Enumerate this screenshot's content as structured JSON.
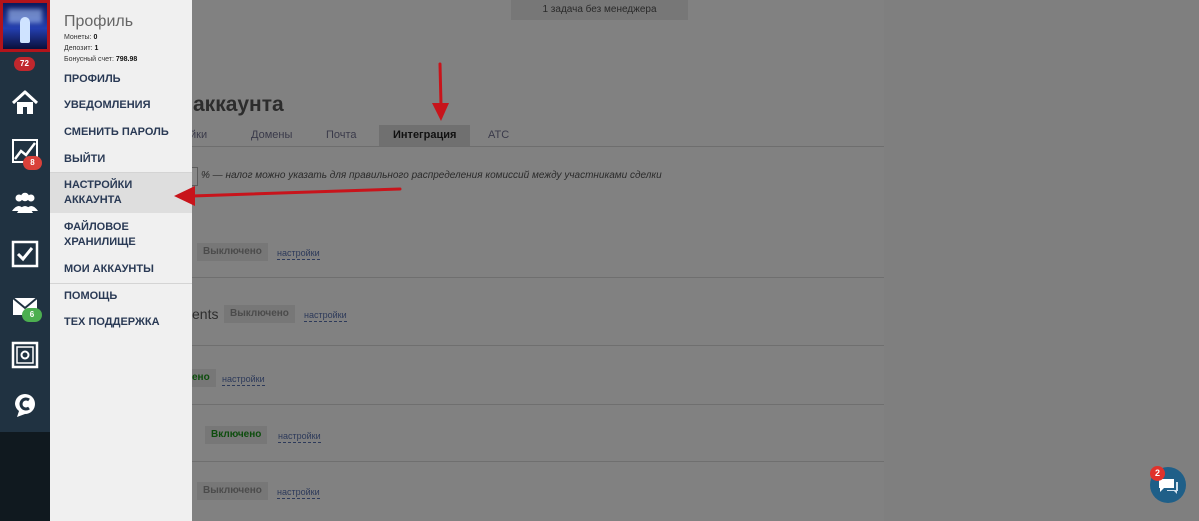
{
  "background": {
    "top_note": "1 задача без менеджера",
    "page_title": "аккаунта",
    "tabs": [
      {
        "label": "йки"
      },
      {
        "label": "Домены"
      },
      {
        "label": "Почта"
      },
      {
        "label": "Интеграция",
        "active": true
      },
      {
        "label": "АТС"
      }
    ],
    "tax_note": "% — налог можно указать для правильного распределения комиссий между участниками сделки",
    "rows": [
      {
        "fragment": "",
        "status": "Выключено",
        "enabled": false,
        "link": "настройки"
      },
      {
        "fragment": "ents",
        "status": "Выключено",
        "enabled": false,
        "link": "настройки"
      },
      {
        "fragment": "",
        "status": "ено",
        "enabled": true,
        "link": "настройки"
      },
      {
        "fragment": "",
        "status": "Включено",
        "enabled": true,
        "link": "настройки"
      },
      {
        "fragment": "",
        "status": "Выключено",
        "enabled": false,
        "link": "настройки"
      }
    ]
  },
  "rail": {
    "avatar_badge": "72",
    "icons": [
      {
        "name": "home-icon"
      },
      {
        "name": "analytics-icon",
        "badge": "8",
        "badge_color": "#d9413a"
      },
      {
        "name": "people-icon"
      },
      {
        "name": "checkbox-tasks-icon"
      },
      {
        "name": "mail-icon",
        "badge": "6",
        "badge_color": "#4caf50"
      },
      {
        "name": "safe-icon"
      },
      {
        "name": "currency-icon"
      }
    ]
  },
  "menu": {
    "title": "Профиль",
    "stats": [
      {
        "label": "Монеты:",
        "value": "0"
      },
      {
        "label": "Депозит:",
        "value": "1"
      },
      {
        "label": "Бонусный счет:",
        "value": "798.98"
      }
    ],
    "items": [
      {
        "label": "ПРОФИЛЬ"
      },
      {
        "label": "УВЕДОМЛЕНИЯ"
      },
      {
        "label": "СМЕНИТЬ ПАРОЛЬ"
      },
      {
        "label": "ВЫЙТИ"
      },
      {
        "label": "НАСТРОЙКИ АККАУНТА",
        "active": true
      },
      {
        "label": "ФАЙЛОВОЕ ХРАНИЛИЩЕ"
      },
      {
        "label": "МОИ АККАУНТЫ"
      },
      {
        "label": "ПОМОЩЬ"
      },
      {
        "label": "ТЕХ ПОДДЕРЖКА"
      }
    ]
  },
  "chat": {
    "badge": "2"
  },
  "colors": {
    "rail": "#203241",
    "menu_bg": "#f0f0f0",
    "menu_text": "#2a3a55",
    "arrow": "#c8141b",
    "avatar_border": "#b2141b"
  }
}
